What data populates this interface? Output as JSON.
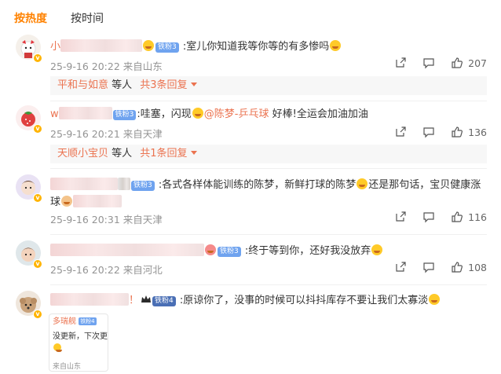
{
  "tabs": {
    "hot": "按热度",
    "time": "按时间"
  },
  "comments": [
    {
      "name_prefix": "小",
      "fan_badge": "铁粉3",
      "text": ":室儿你知道我等你等的有多惨吗",
      "meta": "25-9-16 20:22 来自山东",
      "likes": "207",
      "reply": {
        "users": "平和与如意",
        "mid": " 等人 ",
        "more": "共3条回复"
      }
    },
    {
      "name_prefix": "w",
      "fan_badge": "铁粉3",
      "text_a": ":哇塞，闪现",
      "mention": "@陈梦-乒乓球",
      "text_b": " 好棒!全运会加油加油",
      "meta": "25-9-16 20:21 来自天津",
      "likes": "136",
      "reply": {
        "users": "天顺小宝贝",
        "mid": " 等人 ",
        "more": "共1条回复"
      }
    },
    {
      "fan_badge": "铁粉3",
      "text_a": ":各式各样体能训练的陈梦，新鲜打球的陈梦",
      "text_b": "还是那句话，宝贝健康涨",
      "text_c": "球",
      "meta": "25-9-16 20:31 来自天津",
      "likes": "116"
    },
    {
      "fan_badge": "铁粉3",
      "text": ":终于等到你，还好我没放弃",
      "meta": "25-9-16 20:22 来自河北",
      "likes": "108"
    },
    {
      "name_suffix": "！",
      "fan_badge": "铁粉4",
      "text": ":原谅你了，没事的时候可以抖抖库存不要让我们太寡淡",
      "quote": {
        "name": "多瑞舰",
        "badge": "铁粉4",
        "text": "没更新，下次更新",
        "loc": "来自山东"
      }
    }
  ],
  "colors": {
    "accent": "#ff8200",
    "link": "#eb7350",
    "meta": "#939393"
  },
  "icons": [
    "share-icon",
    "comment-icon",
    "like-icon",
    "verified-badge-icon",
    "crown-icon",
    "emoji-icon"
  ]
}
